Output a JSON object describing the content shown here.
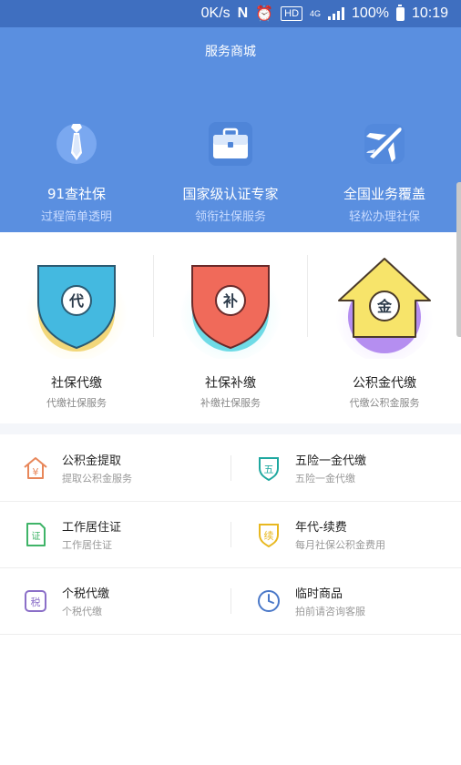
{
  "status": {
    "speed": "0K/s",
    "nfc": "N",
    "hd": "HD",
    "network": "4G",
    "battery": "100%",
    "time": "10:19"
  },
  "banner": {
    "title": "服务商城",
    "features": [
      {
        "title": "91查社保",
        "subtitle": "过程简单透明",
        "icon": "tie-icon"
      },
      {
        "title": "国家级认证专家",
        "subtitle": "领衔社保服务",
        "icon": "briefcase-icon"
      },
      {
        "title": "全国业务覆盖",
        "subtitle": "轻松办理社保",
        "icon": "airplane-icon"
      }
    ]
  },
  "services": [
    {
      "badge": "代",
      "title": "社保代缴",
      "subtitle": "代缴社保服务"
    },
    {
      "badge": "补",
      "title": "社保补缴",
      "subtitle": "补缴社保服务"
    },
    {
      "badge": "金",
      "title": "公积金代缴",
      "subtitle": "代缴公积金服务"
    }
  ],
  "items": [
    {
      "title": "公积金提取",
      "subtitle": "提取公积金服务",
      "icon_char": "¥",
      "color": "#e8875a"
    },
    {
      "title": "五险一金代缴",
      "subtitle": "五险一金代缴",
      "icon_char": "五",
      "color": "#1fa8a0"
    },
    {
      "title": "工作居住证",
      "subtitle": "工作居住证",
      "icon_char": "证",
      "color": "#3fb468"
    },
    {
      "title": "年代-续费",
      "subtitle": "每月社保公积金费用",
      "icon_char": "续",
      "color": "#e8b820"
    },
    {
      "title": "个税代缴",
      "subtitle": "个税代缴",
      "icon_char": "税",
      "color": "#8b6fc8"
    },
    {
      "title": "临时商品",
      "subtitle": "拍前请咨询客服",
      "icon_char": "",
      "color": "#4a78c8"
    }
  ],
  "colors": {
    "banner": "#5a8fe0",
    "status_bar": "#3f6fc0"
  }
}
